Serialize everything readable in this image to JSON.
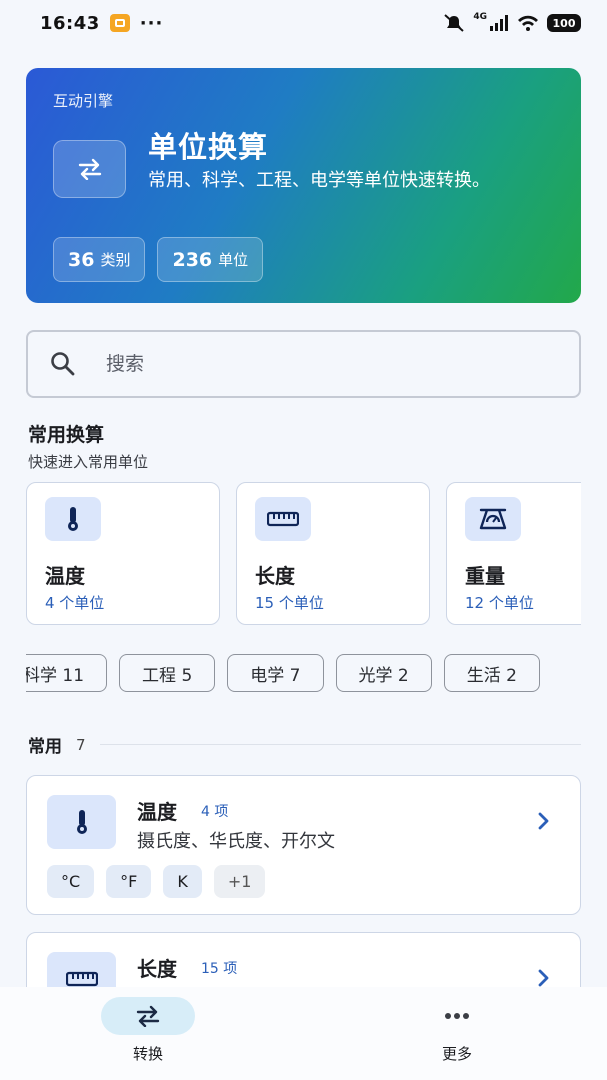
{
  "status_bar": {
    "time": "16:43",
    "dots": "···",
    "network": "4G",
    "battery": "100"
  },
  "hero": {
    "eyebrow": "互动引擎",
    "title": "单位换算",
    "description": "常用、科学、工程、电学等单位快速转换。",
    "icon": "swap-arrows-icon",
    "stats": [
      {
        "number": "36",
        "label": "类别"
      },
      {
        "number": "236",
        "label": "单位"
      }
    ],
    "gradient_colors": [
      "#2b59d6",
      "#1aa080",
      "#22a84a"
    ]
  },
  "search": {
    "placeholder": "搜索",
    "value": ""
  },
  "common_section": {
    "title": "常用换算",
    "subtitle": "快速进入常用单位",
    "cards": [
      {
        "name": "温度",
        "count": "4 个单位",
        "icon": "thermometer-icon"
      },
      {
        "name": "长度",
        "count": "15 个单位",
        "icon": "ruler-icon"
      },
      {
        "name": "重量",
        "count": "12 个单位",
        "icon": "scale-icon"
      }
    ]
  },
  "categories": [
    {
      "label": "科学 11"
    },
    {
      "label": "工程 5"
    },
    {
      "label": "电学 7"
    },
    {
      "label": "光学 2"
    },
    {
      "label": "生活 2"
    }
  ],
  "group": {
    "name": "常用",
    "count": "7"
  },
  "list": [
    {
      "name": "温度",
      "count": "4 项",
      "description": "摄氏度、华氏度、开尔文",
      "icon": "thermometer-icon",
      "tags": [
        "°C",
        "°F",
        "K",
        "+1"
      ]
    },
    {
      "name": "长度",
      "count": "15 项",
      "description": "",
      "icon": "ruler-icon",
      "tags": []
    }
  ],
  "bottom_nav": [
    {
      "label": "转换",
      "icon": "swap-arrows-icon",
      "active": true
    },
    {
      "label": "更多",
      "icon": "more-dots-icon",
      "active": false
    }
  ],
  "colors": {
    "accent_blue": "#2b5fb8",
    "icon_bg": "#dbe6fb",
    "nav_active_bg": "#d7edf8"
  }
}
